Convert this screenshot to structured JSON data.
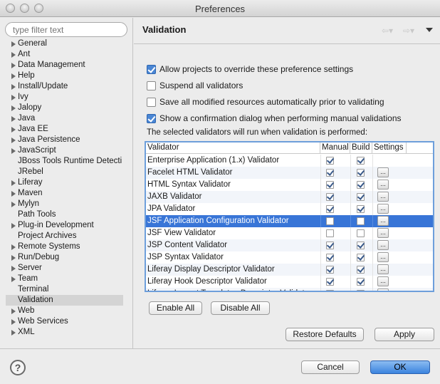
{
  "window": {
    "title": "Preferences"
  },
  "filter": {
    "placeholder": "type filter text"
  },
  "tree": [
    {
      "label": "General",
      "expandable": true
    },
    {
      "label": "Ant",
      "expandable": true
    },
    {
      "label": "Data Management",
      "expandable": true
    },
    {
      "label": "Help",
      "expandable": true
    },
    {
      "label": "Install/Update",
      "expandable": true
    },
    {
      "label": "Ivy",
      "expandable": true
    },
    {
      "label": "Jalopy",
      "expandable": true
    },
    {
      "label": "Java",
      "expandable": true
    },
    {
      "label": "Java EE",
      "expandable": true
    },
    {
      "label": "Java Persistence",
      "expandable": true
    },
    {
      "label": "JavaScript",
      "expandable": true
    },
    {
      "label": "JBoss Tools Runtime Detecti",
      "expandable": false
    },
    {
      "label": "JRebel",
      "expandable": false
    },
    {
      "label": "Liferay",
      "expandable": true
    },
    {
      "label": "Maven",
      "expandable": true
    },
    {
      "label": "Mylyn",
      "expandable": true
    },
    {
      "label": "Path Tools",
      "expandable": false
    },
    {
      "label": "Plug-in Development",
      "expandable": true
    },
    {
      "label": "Project Archives",
      "expandable": false
    },
    {
      "label": "Remote Systems",
      "expandable": true
    },
    {
      "label": "Run/Debug",
      "expandable": true
    },
    {
      "label": "Server",
      "expandable": true
    },
    {
      "label": "Team",
      "expandable": true
    },
    {
      "label": "Terminal",
      "expandable": false
    },
    {
      "label": "Validation",
      "expandable": false,
      "selected": true
    },
    {
      "label": "Web",
      "expandable": true
    },
    {
      "label": "Web Services",
      "expandable": true
    },
    {
      "label": "XML",
      "expandable": true
    }
  ],
  "page": {
    "title": "Validation"
  },
  "options": {
    "allow_override": {
      "label": "Allow projects to override these preference settings",
      "checked": true
    },
    "suspend_all": {
      "label": "Suspend all validators",
      "checked": false
    },
    "save_all": {
      "label": "Save all modified resources automatically prior to validating",
      "checked": false
    },
    "show_confirmation": {
      "label": "Show a confirmation dialog when performing manual validations",
      "checked": true
    }
  },
  "info_text": "The selected validators will run when validation is performed:",
  "table": {
    "headers": {
      "validator": "Validator",
      "manual": "Manual",
      "build": "Build",
      "settings": "Settings"
    },
    "settings_button": "...",
    "rows": [
      {
        "name": "Enterprise Application (1.x) Validator",
        "manual": true,
        "build": true,
        "settings": false
      },
      {
        "name": "Facelet HTML Validator",
        "manual": true,
        "build": true,
        "settings": true
      },
      {
        "name": "HTML Syntax Validator",
        "manual": true,
        "build": true,
        "settings": true
      },
      {
        "name": "JAXB Validator",
        "manual": true,
        "build": true,
        "settings": true
      },
      {
        "name": "JPA Validator",
        "manual": true,
        "build": true,
        "settings": true
      },
      {
        "name": "JSF Application Configuration Validator",
        "manual": false,
        "build": false,
        "settings": true,
        "selected": true
      },
      {
        "name": "JSF View Validator",
        "manual": false,
        "build": false,
        "settings": true
      },
      {
        "name": "JSP Content Validator",
        "manual": true,
        "build": true,
        "settings": true
      },
      {
        "name": "JSP Syntax Validator",
        "manual": true,
        "build": true,
        "settings": true
      },
      {
        "name": "Liferay Display Descriptor Validator",
        "manual": true,
        "build": true,
        "settings": true
      },
      {
        "name": "Liferay Hook Descriptor Validator",
        "manual": true,
        "build": true,
        "settings": true
      },
      {
        "name": "Liferay Layout Templates Descriptor Validator",
        "manual": true,
        "build": true,
        "settings": true
      }
    ]
  },
  "buttons": {
    "enable_all": "Enable All",
    "disable_all": "Disable All",
    "restore_defaults": "Restore Defaults",
    "apply": "Apply",
    "cancel": "Cancel",
    "ok": "OK",
    "help": "?"
  }
}
